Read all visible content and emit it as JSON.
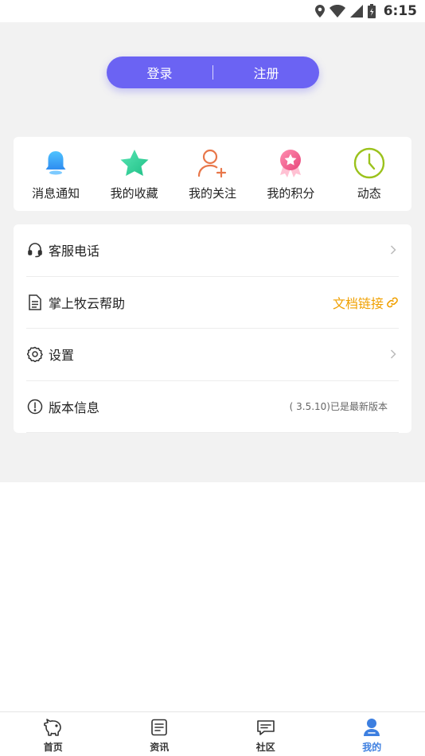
{
  "status_bar": {
    "time": "6:15"
  },
  "auth": {
    "login_label": "登录",
    "register_label": "注册"
  },
  "shortcuts": [
    {
      "label": "消息通知",
      "icon": "bell-icon"
    },
    {
      "label": "我的收藏",
      "icon": "star-icon"
    },
    {
      "label": "我的关注",
      "icon": "add-user-icon"
    },
    {
      "label": "我的积分",
      "icon": "medal-icon"
    },
    {
      "label": "动态",
      "icon": "clock-icon"
    }
  ],
  "menu": {
    "service_phone": {
      "label": "客服电话",
      "icon": "headset-icon"
    },
    "help": {
      "label": "掌上牧云帮助",
      "icon": "document-icon",
      "link_label": "文档链接"
    },
    "settings": {
      "label": "设置",
      "icon": "gear-icon"
    },
    "version": {
      "label": "版本信息",
      "icon": "info-icon",
      "value": "( 3.5.10)已是最新版本"
    }
  },
  "tabs": [
    {
      "label": "首页",
      "icon": "pig-icon",
      "active": false
    },
    {
      "label": "资讯",
      "icon": "news-icon",
      "active": false
    },
    {
      "label": "社区",
      "icon": "chat-icon",
      "active": false
    },
    {
      "label": "我的",
      "icon": "user-icon",
      "active": true
    }
  ],
  "colors": {
    "accent": "#6b63f3",
    "link": "#f0a000",
    "tab_active": "#3d7fe0",
    "background": "#f2f2f2"
  }
}
